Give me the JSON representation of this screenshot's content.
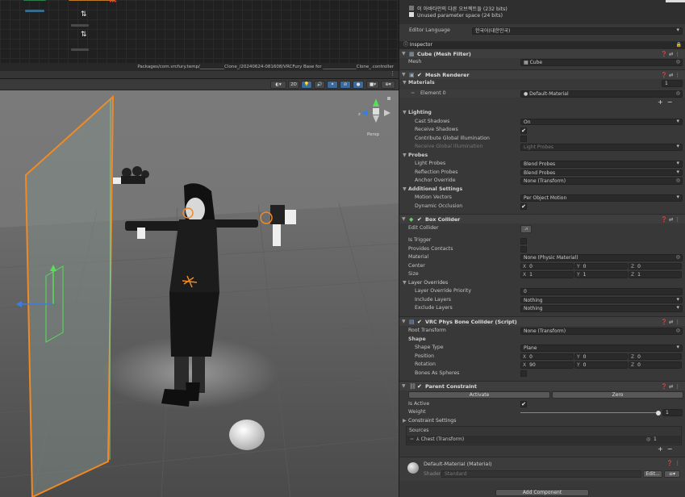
{
  "path_bar": "Packages/com.vrcfury.temp/___________Clone_/20240624-081608/VRCFury Base for _______________Clone_.controller",
  "scene_toolbar": {
    "mode_2d": "2D",
    "buttons": [
      "camera-icon",
      "2d-toggle",
      "lighting-icon",
      "audio-icon",
      "effects-icon",
      "hidden-icon",
      "camera-settings-icon",
      "gizmos-icon"
    ]
  },
  "gizmo": {
    "persp_label": "Persp",
    "axis_x": "x",
    "axis_z": "z"
  },
  "top_info": {
    "line1": "이 아바타안의 다른 오브젝트들 (232 bits)",
    "line2": "Unused parameter space (24 bits)"
  },
  "editor_language": {
    "label": "Editor Language",
    "value": "한국어(대한민국)"
  },
  "inspector_tab": "Inspector",
  "mesh_filter": {
    "title": "Cube (Mesh Filter)",
    "mesh_label": "Mesh",
    "mesh_value": "Cube"
  },
  "mesh_renderer": {
    "title": "Mesh Renderer",
    "materials_label": "Materials",
    "materials_count": "1",
    "element_label": "Element 0",
    "element_value": "Default-Material",
    "lighting": "Lighting",
    "cast_shadows_label": "Cast Shadows",
    "cast_shadows_value": "On",
    "receive_shadows_label": "Receive Shadows",
    "contribute_gi_label": "Contribute Global Illumination",
    "receive_gi_label": "Receive Global Illumination",
    "receive_gi_value": "Light Probes",
    "probes": "Probes",
    "light_probes_label": "Light Probes",
    "light_probes_value": "Blend Probes",
    "reflection_probes_label": "Reflection Probes",
    "reflection_probes_value": "Blend Probes",
    "anchor_override_label": "Anchor Override",
    "anchor_override_value": "None (Transform)",
    "additional": "Additional Settings",
    "motion_vectors_label": "Motion Vectors",
    "motion_vectors_value": "Per Object Motion",
    "dynamic_occlusion_label": "Dynamic Occlusion"
  },
  "box_collider": {
    "title": "Box Collider",
    "edit_collider_label": "Edit Collider",
    "is_trigger_label": "Is Trigger",
    "provides_contacts_label": "Provides Contacts",
    "material_label": "Material",
    "material_value": "None (Physic Material)",
    "center_label": "Center",
    "center": {
      "x": "0",
      "y": "0",
      "z": "0"
    },
    "size_label": "Size",
    "size": {
      "x": "1",
      "y": "1",
      "z": "1"
    },
    "layer_overrides": "Layer Overrides",
    "priority_label": "Layer Override Priority",
    "priority_value": "0",
    "include_label": "Include Layers",
    "include_value": "Nothing",
    "exclude_label": "Exclude Layers",
    "exclude_value": "Nothing"
  },
  "phys_bone_collider": {
    "title": "VRC Phys Bone Collider (Script)",
    "root_label": "Root Transform",
    "root_value": "None (Transform)",
    "shape": "Shape",
    "shape_type_label": "Shape Type",
    "shape_type_value": "Plane",
    "position_label": "Position",
    "position": {
      "x": "0",
      "y": "0",
      "z": "0"
    },
    "rotation_label": "Rotation",
    "rotation": {
      "x": "90",
      "y": "0",
      "z": "0"
    },
    "bones_label": "Bones As Spheres"
  },
  "parent_constraint": {
    "title": "Parent Constraint",
    "activate_label": "Activate",
    "zero_label": "Zero",
    "is_active_label": "Is Active",
    "weight_label": "Weight",
    "weight_value": "1",
    "settings_label": "Constraint Settings",
    "sources_label": "Sources",
    "source_value": "Chest (Transform)",
    "source_weight": "1"
  },
  "material_preview": {
    "name": "Default-Material (Material)",
    "shader_label": "Shader",
    "shader_value": "Standard",
    "edit_label": "Edit..."
  },
  "add_component_label": "Add Component",
  "axis_labels": {
    "x": "X",
    "y": "Y",
    "z": "Z"
  },
  "colors": {
    "accent_orange": "#f08a24",
    "selected_blue": "#3d6a9c",
    "panel": "#383838"
  }
}
